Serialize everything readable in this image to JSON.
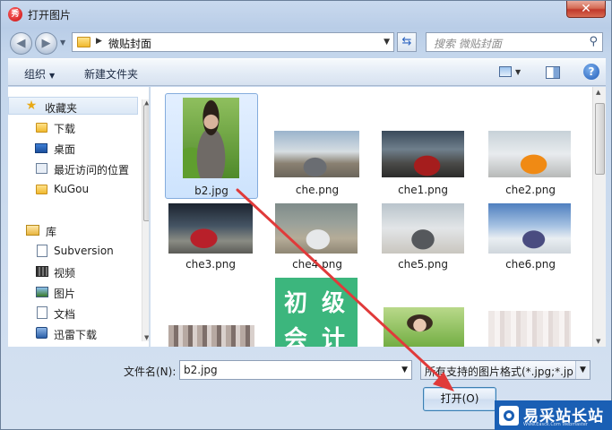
{
  "window": {
    "title": "打开图片",
    "app_icon_text": "秀",
    "close_symbol": "✕"
  },
  "address": {
    "path": "微贴封面",
    "search_placeholder": "搜索 微贴封面"
  },
  "toolbar": {
    "organize": "组织",
    "new_folder": "新建文件夹"
  },
  "nav": {
    "favorites_header": "收藏夹",
    "favorites": [
      "下载",
      "桌面",
      "最近访问的位置",
      "KuGou"
    ],
    "library_header": "库",
    "library": [
      "Subversion",
      "视频",
      "图片",
      "文档",
      "迅雷下载"
    ]
  },
  "files": [
    {
      "name": "b2.jpg",
      "selected": true
    },
    {
      "name": "che.png"
    },
    {
      "name": "che1.png"
    },
    {
      "name": "che2.png"
    },
    {
      "name": "che3.png"
    },
    {
      "name": "che4.png"
    },
    {
      "name": "che5.png"
    },
    {
      "name": "che6.png"
    }
  ],
  "partial_thumb_text": [
    "初",
    "级",
    "会",
    "计"
  ],
  "bottom": {
    "filename_label": "文件名(N):",
    "filename_value": "b2.jpg",
    "filter_value": "所有支持的图片格式(*.jpg;*.jp",
    "open_button": "打开(O)"
  },
  "watermark": {
    "text": "易采站长站",
    "sub": "Www.Easck.Com Webmaster"
  },
  "colors": {
    "selection": "#cde3fd",
    "annotation_arrow": "#e03a3a",
    "watermark_bg": "#1a5fb4"
  }
}
